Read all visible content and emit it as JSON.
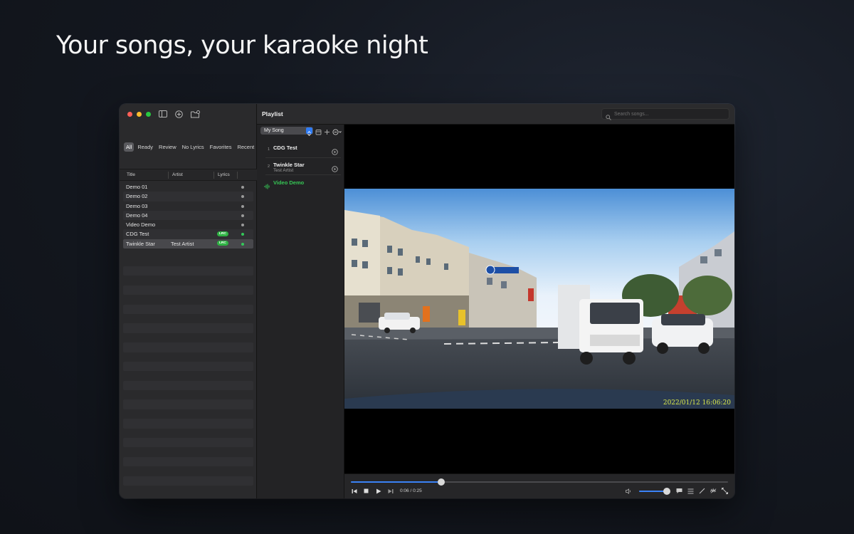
{
  "headline": "Your songs, your karaoke night",
  "window": {
    "toolbar_icons": [
      "sidebar-toggle-icon",
      "add-circle-icon",
      "folder-add-icon"
    ]
  },
  "sidebar": {
    "filters": [
      "All",
      "Ready",
      "Review",
      "No Lyrics",
      "Favorites",
      "Recent"
    ],
    "active_filter": "All",
    "columns": {
      "title": "Title",
      "artist": "Artist",
      "lyrics": "Lyrics"
    },
    "songs": [
      {
        "title": "Demo 01",
        "artist": "",
        "lyrics": "",
        "status": "none"
      },
      {
        "title": "Demo 02",
        "artist": "",
        "lyrics": "",
        "status": "none"
      },
      {
        "title": "Demo 03",
        "artist": "",
        "lyrics": "",
        "status": "none"
      },
      {
        "title": "Demo 04",
        "artist": "",
        "lyrics": "",
        "status": "none"
      },
      {
        "title": "Video Demo",
        "artist": "",
        "lyrics": "",
        "status": "none"
      },
      {
        "title": "CDG Test",
        "artist": "",
        "lyrics": "LRC",
        "status": "ready"
      },
      {
        "title": "Twinkle Star",
        "artist": "Test Artist",
        "lyrics": "LRC",
        "status": "ready"
      }
    ],
    "selected_index": 6
  },
  "header": {
    "title": "Playlist",
    "search_placeholder": "Search songs..."
  },
  "playlist": {
    "selected": "My Song",
    "items": [
      {
        "num": "1",
        "name": "CDG Test",
        "artist": ""
      },
      {
        "num": "2",
        "name": "Twinkle Star",
        "artist": "Test Artist"
      },
      {
        "num": "",
        "name": "Video Demo",
        "artist": "",
        "playing": true
      }
    ]
  },
  "player": {
    "timestamp_overlay": "2022/01/12 16:06:20",
    "time_display": "0:06 / 0:25",
    "progress_fraction": 0.24,
    "volume_fraction": 0.92,
    "accent_color": "#3b82f6",
    "now_playing_color": "#36c755"
  }
}
